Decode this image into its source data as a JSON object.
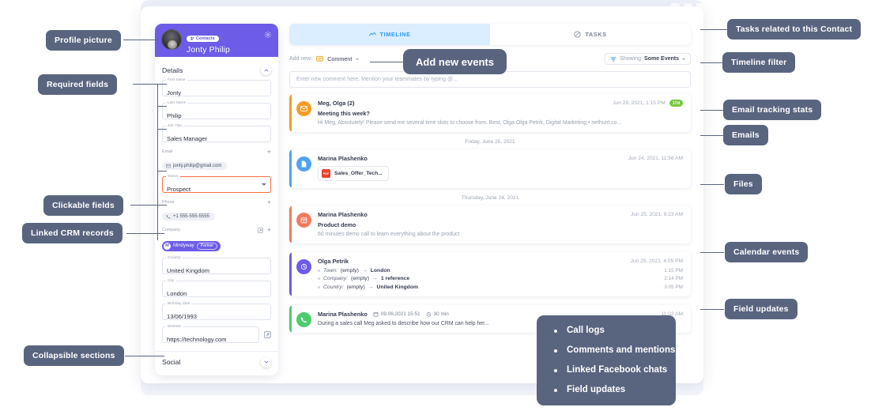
{
  "record": {
    "chip_label": "Contacts",
    "name": "Jonty Philip",
    "details_title": "Details",
    "fields": [
      {
        "label": "First name",
        "value": "Jonty"
      },
      {
        "label": "Last Name",
        "value": "Philip"
      },
      {
        "label": "Job Title",
        "value": "Sales Manager"
      }
    ],
    "email_label": "Email",
    "email_value": "jonty.philip@gmail.com",
    "status_label": "Status",
    "status_value": "Prospect",
    "phone_label": "Phone",
    "phone_value": "+1 555-555-5555",
    "company_label": "Company",
    "company_name": "Mindyway",
    "company_initial": "M",
    "company_tag": "Partner",
    "fields2": [
      {
        "label": "Country",
        "value": "United Kingdom"
      },
      {
        "label": "City",
        "value": "London"
      },
      {
        "label": "Birthday date",
        "value": "13/06/1993"
      },
      {
        "label": "Website",
        "value": "https://technology.com"
      }
    ],
    "social_title": "Social"
  },
  "tabs": [
    {
      "label": "TIMELINE",
      "icon": "trend-line-icon",
      "active": true
    },
    {
      "label": "TASKS",
      "icon": "task-check-icon",
      "active": false
    }
  ],
  "toolbar": {
    "add_new_label": "Add new:",
    "add_new_value": "Comment",
    "showing_label": "Showing",
    "showing_value": "Some Events"
  },
  "composer": {
    "placeholder": "Enter new comment here. Mention your teammates by typing @..."
  },
  "timeline": [
    {
      "type": "email",
      "who": "Meg, Olga (2)",
      "time": "Jun 28, 2021, 1:15 PM",
      "badge": "17d",
      "subject": "Meeting this week?",
      "body": "Hi Meg, Absolutely! Please send me several time slots to choose from. Best, Olga Olga Petrik, Digital Marketing • nethunt.co...",
      "icon": "envelope-icon",
      "color": "#f89a26",
      "strip": "#f89a26"
    },
    {
      "day_separator": "Friday, June 25, 2021"
    },
    {
      "type": "file",
      "who": "Marina Plashenko",
      "time": "Jun 24, 2021, 11:56 AM",
      "file_name": "Sales_Offer_Tech...",
      "file_kind": "PDF",
      "icon": "document-icon",
      "color": "#4fa3f0",
      "strip": "#4fa3f0"
    },
    {
      "day_separator": "Thursday, June 24, 2021"
    },
    {
      "type": "calendar",
      "who": "Marina Plashenko",
      "time": "Jun 25, 2021, 9:23 AM",
      "subject": "Product demo",
      "body": "60 minutes demo call to learn everything about the product",
      "icon": "calendar-icon",
      "color": "#f4795f",
      "strip": "#f4795f"
    },
    {
      "type": "field-updates",
      "who": "Olga Petrik",
      "time": "Jun 25, 2021, 4:05 PM",
      "icon": "history-clock-icon",
      "color": "#6c5ce7",
      "strip": "#6c5ce7",
      "updates": [
        {
          "key": "Town:",
          "old": "(empty)",
          "new": "London",
          "time": "1:15 PM"
        },
        {
          "key": "Company:",
          "old": "(empty)",
          "new": "1 reference",
          "time": "2:14 PM"
        },
        {
          "key": "Country:",
          "old": "(empty)",
          "new": "United Kingdom",
          "time": "3:05 PM"
        }
      ]
    },
    {
      "type": "call",
      "who": "Marina Plashenko",
      "call_date": "09.06.2021 15:51",
      "call_duration": "30 min",
      "time": "11:02 AM",
      "body": "During a sales call Meg asked to describe how our CRM can help her...",
      "icon": "phone-icon",
      "color": "#4dcb6e",
      "strip": "#4dcb6e"
    }
  ],
  "annotations": {
    "left": [
      {
        "label": "Profile picture"
      },
      {
        "label": "Required fields"
      },
      {
        "label": "Clickable fields"
      },
      {
        "label": "Linked CRM records"
      },
      {
        "label": "Collapsible sections"
      }
    ],
    "right": [
      {
        "label": "Tasks related to this Contact"
      },
      {
        "label": "Timeline filter"
      },
      {
        "label": "Email tracking stats"
      },
      {
        "label": "Emails"
      },
      {
        "label": "Files"
      },
      {
        "label": "Calendar events"
      },
      {
        "label": "Field updates"
      }
    ],
    "center": {
      "label": "Add new events"
    },
    "list": {
      "items": [
        "Call logs",
        "Comments and mentions",
        "Linked Facebook chats",
        "Field updates"
      ]
    }
  },
  "colors": {
    "brand_purple": "#6c5ce7",
    "accent_orange": "#f96f45",
    "callout_slate": "#59657f",
    "tab_active_bg": "#dbeeff",
    "tab_active_fg": "#2e9bf0"
  }
}
